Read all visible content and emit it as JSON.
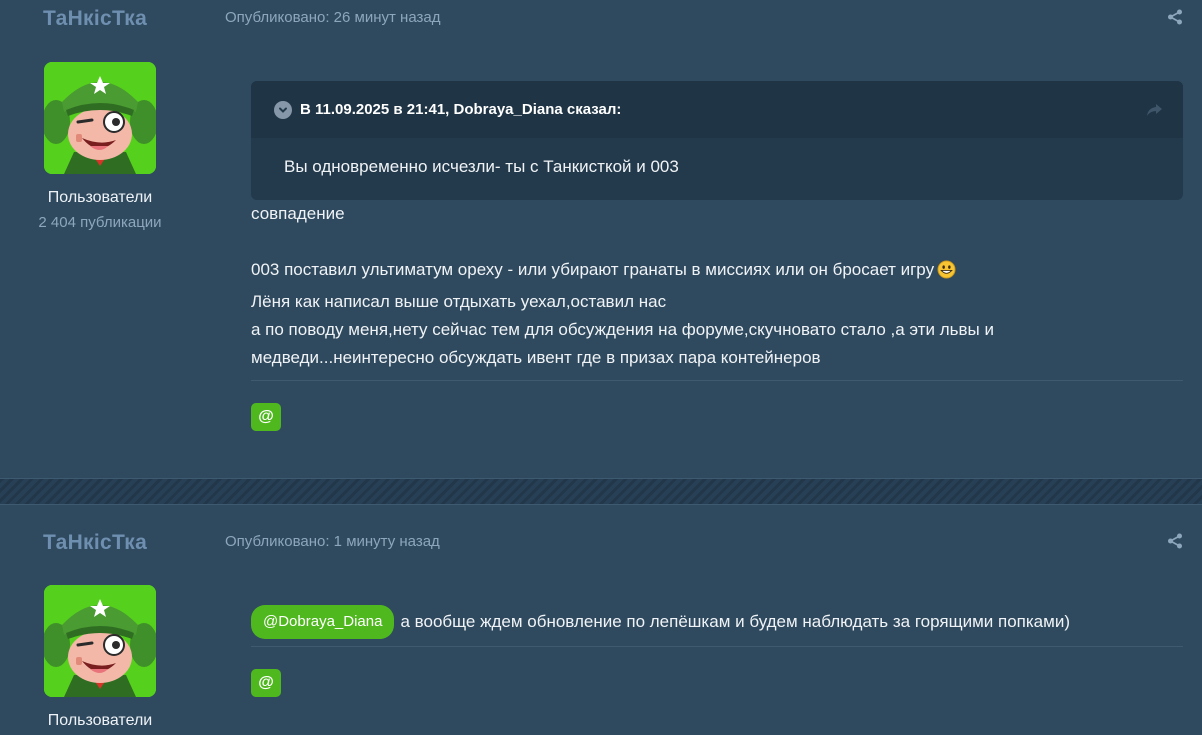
{
  "posts": [
    {
      "author": "ТаНкісТка",
      "time": "Опубликовано: 26 минут назад",
      "group": "Пользователи",
      "post_count": "2 404 публикации",
      "quote": {
        "title": "В 11.09.2025 в 21:41, Dobraya_Diana сказал:",
        "text": "Вы одновременно исчезли- ты с  Танкисткой и 003"
      },
      "lines": [
        "совпадение",
        "",
        "003 поставил ультиматум ореху - или убирают гранаты в миссиях или он бросает игру",
        "Лёня как написал выше отдыхать уехал,оставил нас",
        "а по поводу меня,нету сейчас тем для обсуждения на форуме,скучновато стало ,а эти львы и",
        "медведи...неинтересно обсуждать ивент где в призах пара контейнеров"
      ],
      "mention_button": "@"
    },
    {
      "author": "ТаНкісТка",
      "time": "Опубликовано: 1 минуту назад",
      "group": "Пользователи",
      "mention_tag": "@Dobraya_Diana",
      "text": "а вообще ждем обновление по лепёшкам и будем наблюдать за горящими попками)",
      "mention_button": "@"
    }
  ],
  "icons": [
    "share-icon",
    "chevron-down-icon",
    "quote-share-icon",
    "grinning-emoji-icon",
    "avatar-image"
  ],
  "colors": {
    "background": "#2f4a5f",
    "author": "#6f8fb0",
    "accent_green": "#4fb81e",
    "quote_bg": "#233a4c"
  }
}
